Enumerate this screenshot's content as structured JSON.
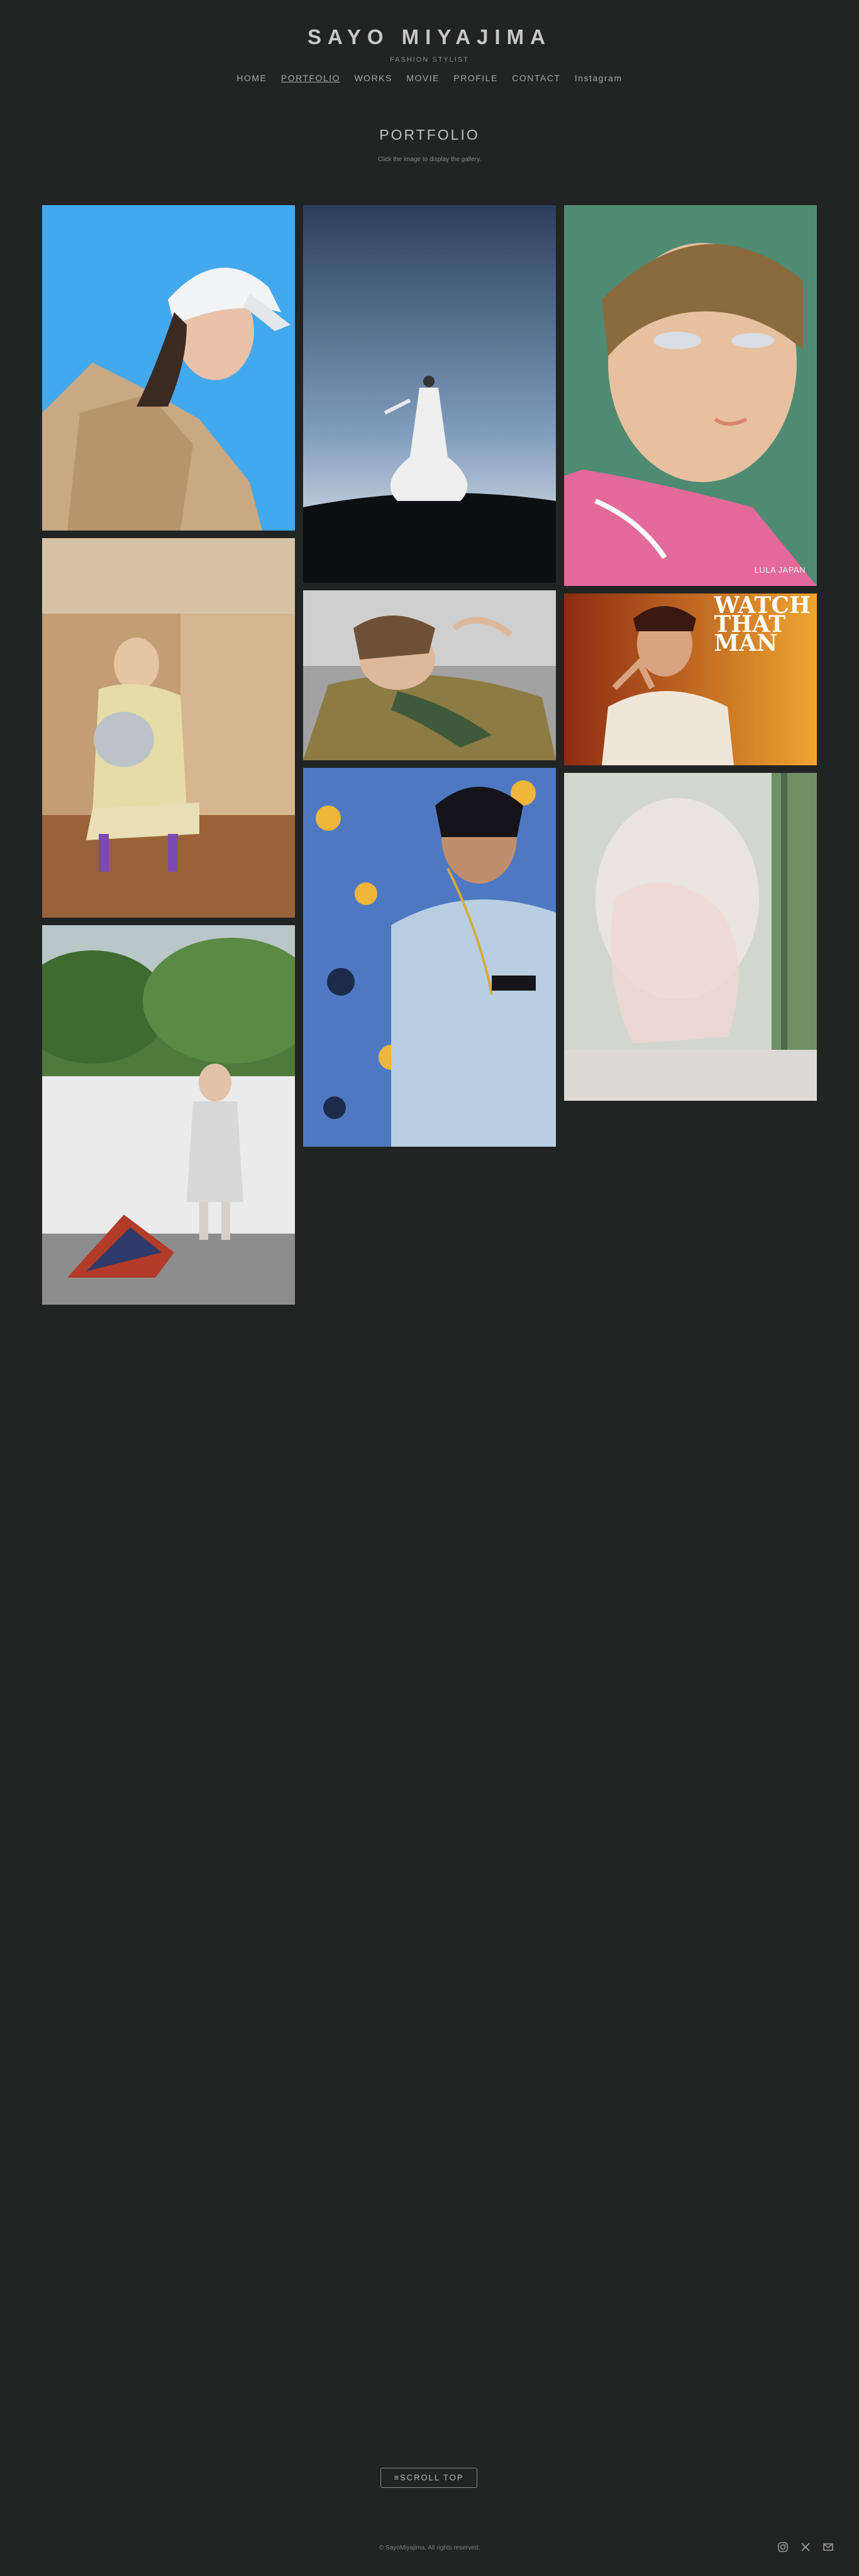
{
  "site": {
    "title": "SAYO MIYAJIMA",
    "subtitle": "FASHION STYLIST"
  },
  "nav": {
    "items": [
      {
        "label": "HOME"
      },
      {
        "label": "PORTFOLIO",
        "active": true
      },
      {
        "label": "WORKS"
      },
      {
        "label": "MOVIE"
      },
      {
        "label": "PROFILE"
      },
      {
        "label": "CONTACT"
      },
      {
        "label": "Instagram"
      }
    ]
  },
  "page": {
    "title": "PORTFOLIO",
    "hint": "Click the image to display the gallery."
  },
  "gallery": {
    "captions": {
      "lula": "LULA JAPAN",
      "magazine_line1": "WATCH",
      "magazine_line2": "THAT",
      "magazine_line3": "MAN"
    }
  },
  "footer": {
    "scroll_top": "≡SCROLL TOP",
    "copyright": "© SayoMiyajima. All rights reserved.",
    "social_icons": [
      "instagram-icon",
      "x-icon",
      "mail-icon"
    ]
  },
  "colors": {
    "background": "#222323",
    "text": "#bdbdbd"
  }
}
